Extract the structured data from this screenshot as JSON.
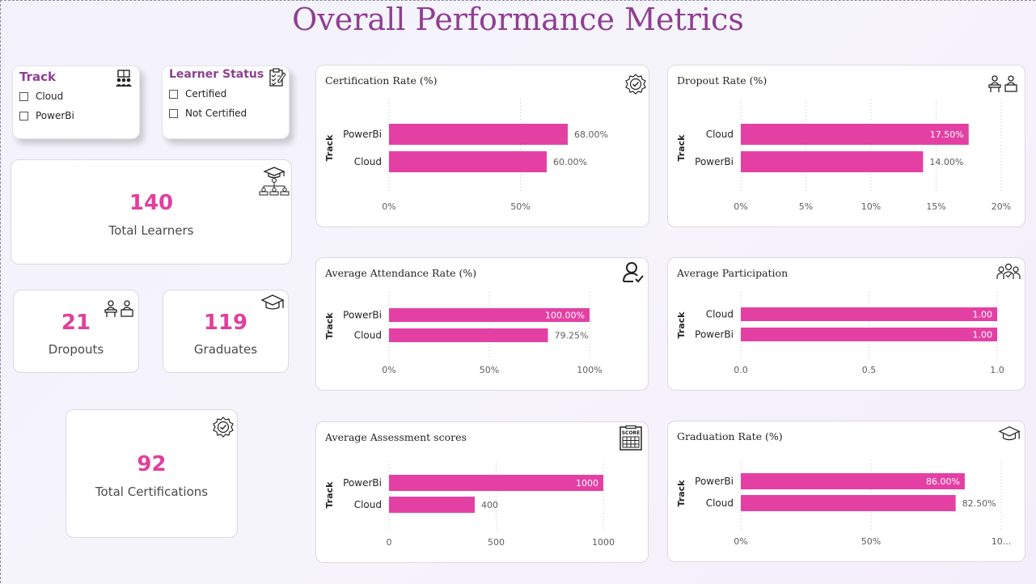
{
  "page": {
    "title": "Overall Performance Metrics"
  },
  "slicers": {
    "track": {
      "title": "Track",
      "items": [
        "Cloud",
        "PowerBi"
      ]
    },
    "status": {
      "title": "Learner Status",
      "items": [
        "Certified",
        "Not Certified"
      ]
    }
  },
  "kpis": {
    "total_learners": {
      "value": "140",
      "label": "Total Learners"
    },
    "dropouts": {
      "value": "21",
      "label": "Dropouts"
    },
    "graduates": {
      "value": "119",
      "label": "Graduates"
    },
    "certifications": {
      "value": "92",
      "label": "Total Certifications"
    }
  },
  "colors": {
    "bar": "#e440a4",
    "title": "#8f3f93",
    "kpi": "#e0409e"
  },
  "chart_data": [
    {
      "id": "certification",
      "type": "bar",
      "orientation": "horizontal",
      "title": "Certification Rate (%)",
      "ylabel": "Track",
      "categories": [
        "PowerBi",
        "Cloud"
      ],
      "values": [
        68,
        60
      ],
      "labels": [
        "68.00%",
        "60.00%"
      ],
      "xlim": [
        0,
        80
      ],
      "ticks": [
        0,
        50
      ],
      "tick_labels": [
        "0%",
        "50%"
      ],
      "icon": "certified-badge-icon"
    },
    {
      "id": "dropout",
      "type": "bar",
      "orientation": "horizontal",
      "title": "Dropout Rate (%)",
      "ylabel": "Track",
      "categories": [
        "Cloud",
        "PowerBi"
      ],
      "values": [
        17.5,
        14
      ],
      "labels": [
        "17.50%",
        "14.00%"
      ],
      "xlim": [
        0,
        20
      ],
      "ticks": [
        0,
        5,
        10,
        15,
        20
      ],
      "tick_labels": [
        "0%",
        "5%",
        "10%",
        "15%",
        "20%"
      ],
      "icon": "dropout-desks-icon"
    },
    {
      "id": "attendance",
      "type": "bar",
      "orientation": "horizontal",
      "title": "Average Attendance Rate (%)",
      "ylabel": "Track",
      "categories": [
        "PowerBi",
        "Cloud"
      ],
      "values": [
        100,
        79.25
      ],
      "labels": [
        "100.00%",
        "79.25%"
      ],
      "xlim": [
        0,
        100
      ],
      "ticks": [
        0,
        50,
        100
      ],
      "tick_labels": [
        "0%",
        "50%",
        "100%"
      ],
      "icon": "user-check-icon"
    },
    {
      "id": "participation",
      "type": "bar",
      "orientation": "horizontal",
      "title": "Average Participation",
      "ylabel": "Track",
      "categories": [
        "Cloud",
        "PowerBi"
      ],
      "values": [
        1,
        1
      ],
      "labels": [
        "1.00",
        "1.00"
      ],
      "xlim": [
        0,
        1
      ],
      "ticks": [
        0,
        0.5,
        1
      ],
      "tick_labels": [
        "0.0",
        "0.5",
        "1.0"
      ],
      "icon": "group-icon"
    },
    {
      "id": "assessment",
      "type": "bar",
      "orientation": "horizontal",
      "title": "Average Assessment scores",
      "ylabel": "Track",
      "categories": [
        "PowerBi",
        "Cloud"
      ],
      "values": [
        1000,
        400
      ],
      "labels": [
        "1000",
        "400"
      ],
      "xlim": [
        0,
        1000
      ],
      "ticks": [
        0,
        500,
        1000
      ],
      "tick_labels": [
        "0",
        "500",
        "1000"
      ],
      "icon": "score-sheet-icon"
    },
    {
      "id": "graduation",
      "type": "bar",
      "orientation": "horizontal",
      "title": "Graduation Rate (%)",
      "ylabel": "Track",
      "categories": [
        "PowerBi",
        "Cloud"
      ],
      "values": [
        86,
        82.5
      ],
      "labels": [
        "86.00%",
        "82.50%"
      ],
      "xlim": [
        0,
        100
      ],
      "ticks": [
        0,
        50,
        100
      ],
      "tick_labels": [
        "0%",
        "50%",
        "10..."
      ],
      "icon": "graduation-cap-icon"
    }
  ]
}
